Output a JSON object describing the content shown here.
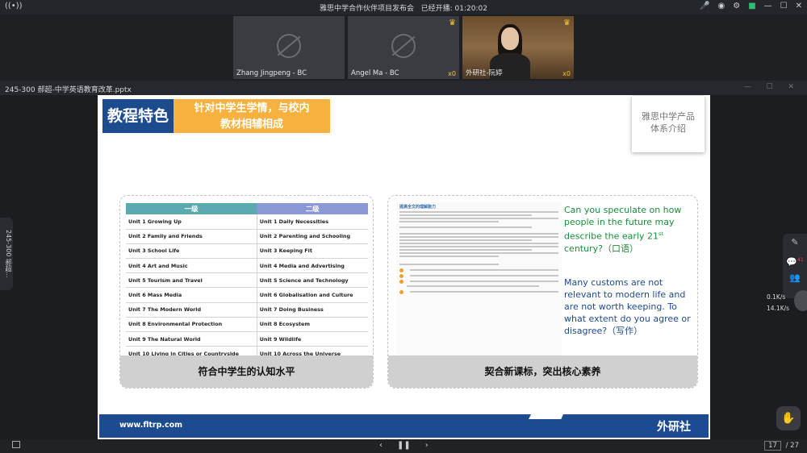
{
  "meeting": {
    "title": "雅思中学合作伙伴项目发布会",
    "elapsed": "已经开播: 01:20:02"
  },
  "participants": [
    {
      "name": "Zhang Jingpeng - BC",
      "count": ""
    },
    {
      "name": "Angel Ma - BC",
      "count": "x0"
    },
    {
      "name": "外研社-阮婷",
      "count": "x0"
    }
  ],
  "file": {
    "name": "245-300 郝超-中学英语教育改革.pptx"
  },
  "slide": {
    "tag_dark": "教程特色",
    "tag_orange_line1": "针对中学生学情，与校内",
    "tag_orange_line2": "教材相辅相成",
    "product_line1": "雅思中学产品",
    "product_line2": "体系介绍",
    "table": {
      "headers": [
        "一级",
        "二级"
      ],
      "rows": [
        [
          "Unit 1 Growing Up",
          "Unit 1 Daily Necessities"
        ],
        [
          "Unit 2 Family and Friends",
          "Unit 2 Parenting and Schooling"
        ],
        [
          "Unit 3 School Life",
          "Unit 3 Keeping Fit"
        ],
        [
          "Unit 4 Art and Music",
          "Unit 4 Media and Advertising"
        ],
        [
          "Unit 5 Tourism and Travel",
          "Unit 5 Science and Technology"
        ],
        [
          "Unit 6 Mass Media",
          "Unit 6 Globalisation and Culture"
        ],
        [
          "Unit 7 The Modern World",
          "Unit 7 Doing Business"
        ],
        [
          "Unit 8 Environmental Protection",
          "Unit 8 Ecosystem"
        ],
        [
          "Unit 9 The Natural World",
          "Unit 9 Wildlife"
        ],
        [
          "Unit 10 Living in Cities or Countryside",
          "Unit 10 Across the Universe"
        ]
      ]
    },
    "left_caption": "符合中学生的认知水平",
    "right_caption": "契合新课标，突出核心素养",
    "excerpt_heading": "提高全文的理解能力",
    "q1_before": "Can you speculate on how people in the future may describe the early 21",
    "q1_sup": "st",
    "q1_after": " century?（口语）",
    "q2": "Many customs are not relevant to modern life and are not worth keeping. To what extent do you agree or disagree?（写作）",
    "footer_url": "www.fltrp.com",
    "footer_publisher": "外研社"
  },
  "sidebar_tab": "245-300 郝超...",
  "right_panel_badge": "41",
  "network": {
    "up": "0.1K/s",
    "down": "14.1K/s"
  },
  "pager": {
    "current": "17",
    "total": "/ 27"
  },
  "colors": {
    "navy": "#1d4b8f",
    "orange": "#f6b13f",
    "green_text": "#1a8c3b",
    "teal_header": "#5aaab0",
    "purple_header": "#8a98d6"
  }
}
